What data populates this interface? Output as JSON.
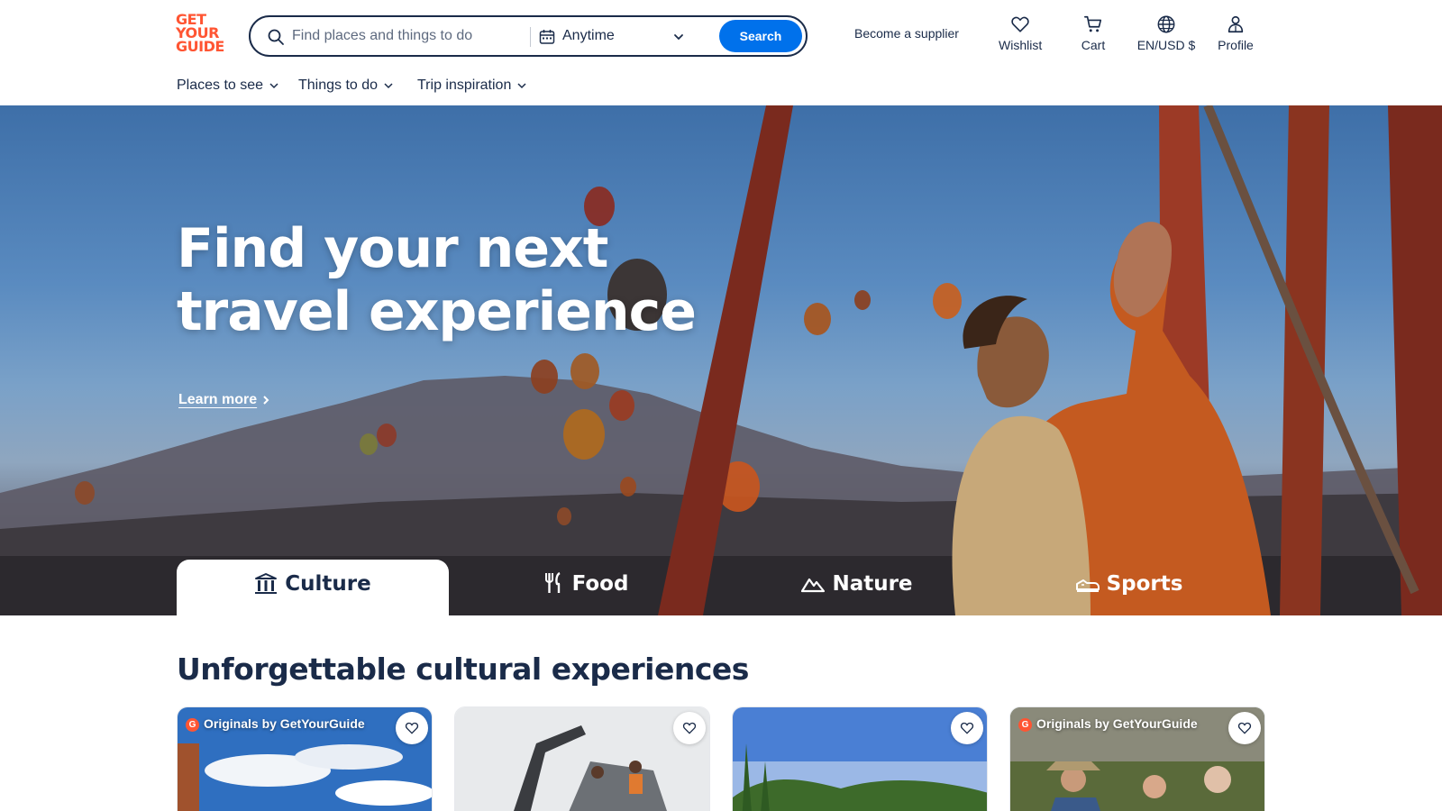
{
  "header": {
    "logo": [
      "GET",
      "YOUR",
      "GUIDE"
    ],
    "search": {
      "placeholder": "Find places and things to do",
      "date_label": "Anytime",
      "button_label": "Search"
    },
    "supplier_link": "Become a supplier",
    "actions": {
      "wishlist": "Wishlist",
      "cart": "Cart",
      "locale": "EN/USD $",
      "profile": "Profile"
    }
  },
  "nav": {
    "items": [
      "Places to see",
      "Things to do",
      "Trip inspiration"
    ]
  },
  "hero": {
    "title": "Find your next travel experience",
    "learn_more": "Learn more",
    "tabs": [
      {
        "label": "Culture",
        "icon": "culture-icon",
        "active": true
      },
      {
        "label": "Food",
        "icon": "fork-knife-icon",
        "active": false
      },
      {
        "label": "Nature",
        "icon": "mountain-icon",
        "active": false
      },
      {
        "label": "Sports",
        "icon": "sneaker-icon",
        "active": false
      }
    ]
  },
  "section": {
    "title": "Unforgettable cultural experiences",
    "cards": [
      {
        "badge": "Originals by GetYourGuide",
        "badge_logo": "G"
      },
      {
        "badge": ""
      },
      {
        "badge": ""
      },
      {
        "badge": "Originals by GetYourGuide",
        "badge_logo": "G"
      }
    ]
  },
  "colors": {
    "brand": "#ff5533",
    "primary_button": "#0071eb",
    "text": "#1a2b49"
  }
}
